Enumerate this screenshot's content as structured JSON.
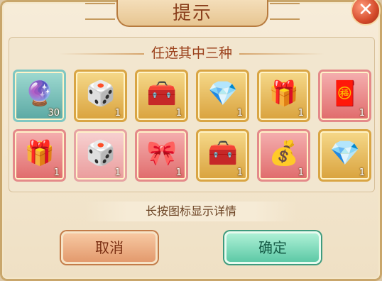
{
  "dialog": {
    "title": "提示",
    "close_glyph": "✕",
    "subtitle": "任选其中三种",
    "hint": "长按图标显示详情"
  },
  "items": [
    {
      "icon": "crystal-orb-icon",
      "glyph": "🔮",
      "count": "30",
      "frame": "blue"
    },
    {
      "icon": "dice-gift-box-icon",
      "glyph": "🎲",
      "count": "1",
      "frame": "gold"
    },
    {
      "icon": "character-chest-icon",
      "glyph": "🧰",
      "count": "1",
      "frame": "gold"
    },
    {
      "icon": "crystal-chest-icon",
      "glyph": "💎",
      "count": "1",
      "frame": "gold"
    },
    {
      "icon": "red-treasure-box-icon",
      "glyph": "🎁",
      "count": "1",
      "frame": "gold"
    },
    {
      "icon": "lucky-bag-icon",
      "glyph": "🧧",
      "count": "1",
      "frame": "red"
    },
    {
      "icon": "red-octagon-box-icon",
      "glyph": "🎁",
      "count": "1",
      "frame": "red"
    },
    {
      "icon": "blue-dice-box-icon",
      "glyph": "🎲",
      "count": "1",
      "frame": "pink"
    },
    {
      "icon": "pink-gift-box-icon",
      "glyph": "🎀",
      "count": "1",
      "frame": "red"
    },
    {
      "icon": "golden-chest-icon",
      "glyph": "🧰",
      "count": "1",
      "frame": "gold"
    },
    {
      "icon": "money-pouch-icon",
      "glyph": "💰",
      "count": "1",
      "frame": "red"
    },
    {
      "icon": "jeweled-chest-icon",
      "glyph": "💎",
      "count": "1",
      "frame": "gold"
    }
  ],
  "buttons": {
    "cancel": "取消",
    "confirm": "确定"
  }
}
